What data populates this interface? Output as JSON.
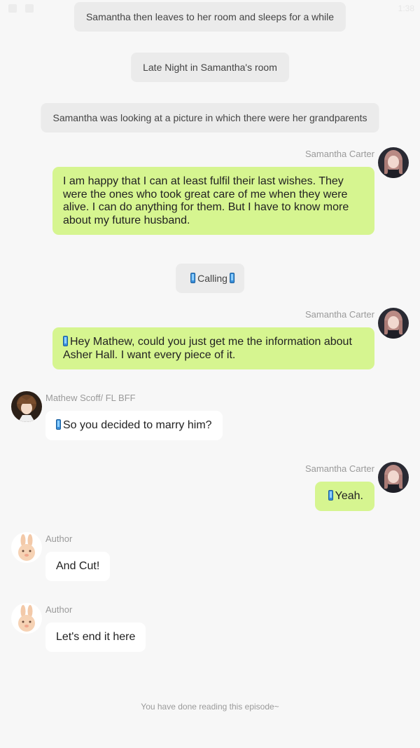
{
  "status_bar": {
    "time": "1:38",
    "icons": [
      "image-icon",
      "add-icon"
    ]
  },
  "colors": {
    "background": "#f7f7f7",
    "narration_bubble": "#ebebeb",
    "self_bubble": "#d6f590",
    "other_bubble": "#ffffff",
    "name_text": "#9a9a9a"
  },
  "narrations": {
    "n1": "Samantha then leaves to her room and sleeps for a while",
    "n2": "Late Night in Samantha's room",
    "n3": "Samantha was looking at a picture in which there were her grandparents",
    "n4": "Calling"
  },
  "messages": {
    "m1": {
      "sender": "Samantha Carter",
      "text": "I am happy that I can at least fulfil their last wishes. They were the ones who took great care of me when they were alive. I can do anything for them. But I have to know more about my future husband."
    },
    "m2": {
      "sender": "Samantha Carter",
      "text": "Hey Mathew, could you just get me the information about Asher Hall. I want every piece of it."
    },
    "m3": {
      "sender": "Mathew Scoff/ FL BFF",
      "text": "So you decided to marry him?"
    },
    "m4": {
      "sender": "Samantha Carter",
      "text": "Yeah."
    },
    "m5": {
      "sender": "Author",
      "text": "And Cut!"
    },
    "m6": {
      "sender": "Author",
      "text": "Let's end it here"
    }
  },
  "footer": {
    "text": "You have done reading this episode~"
  }
}
